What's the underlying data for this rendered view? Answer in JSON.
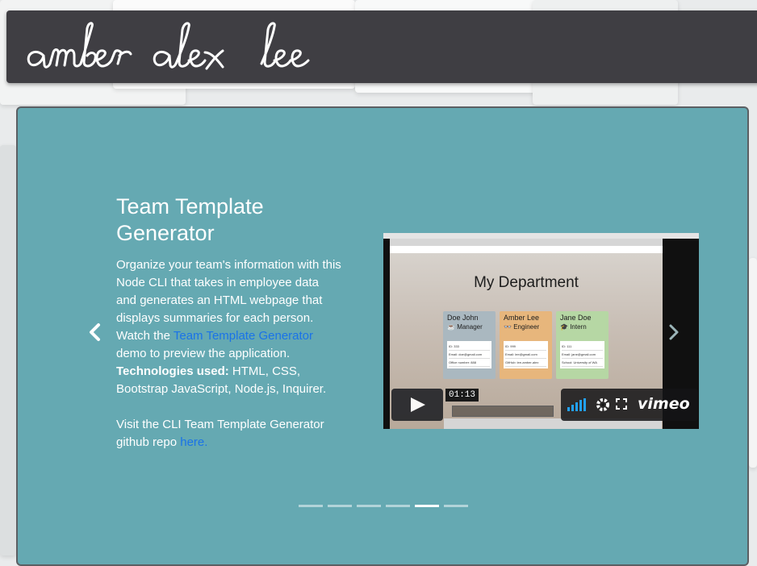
{
  "header": {
    "signature": "amber alex lee"
  },
  "carousel": {
    "slide": {
      "title": "Team Template Generator",
      "desc_before_link": "Organize your team's information with this Node CLI that takes in employee data and generates an HTML webpage that displays summaries for each person. Watch the ",
      "demo_link": "Team Template Generator",
      "desc_after_link": " demo to preview the application.",
      "tech_label": "Technologies used:",
      "tech_list": " HTML, CSS, Bootstrap JavaScript, Node.js, Inquirer.",
      "repo_before_link": "Visit the CLI Team Template Generator github repo ",
      "repo_link": "here."
    },
    "indicator_count": 6,
    "active_indicator": 4
  },
  "video": {
    "page_title": "My Department",
    "employees": [
      {
        "name": "Doe John",
        "role": "Manager",
        "id": "ID: 333",
        "email": "Email: doe@gmail.com",
        "extra": "Office number: 888",
        "color": "#aab8c0"
      },
      {
        "name": "Amber Lee",
        "role": "Engineer",
        "id": "ID: 999",
        "email": "Email: lee@gmail.com",
        "extra": "GitHub: lee-amber-alex",
        "color": "#e7b67c"
      },
      {
        "name": "Jane Doe",
        "role": "Intern",
        "id": "ID: 111",
        "email": "Email: jane@gmail.com",
        "extra": "School: University of WA",
        "color": "#b6d7a4"
      }
    ],
    "timestamp": "01:13",
    "brand": "vimeo"
  }
}
